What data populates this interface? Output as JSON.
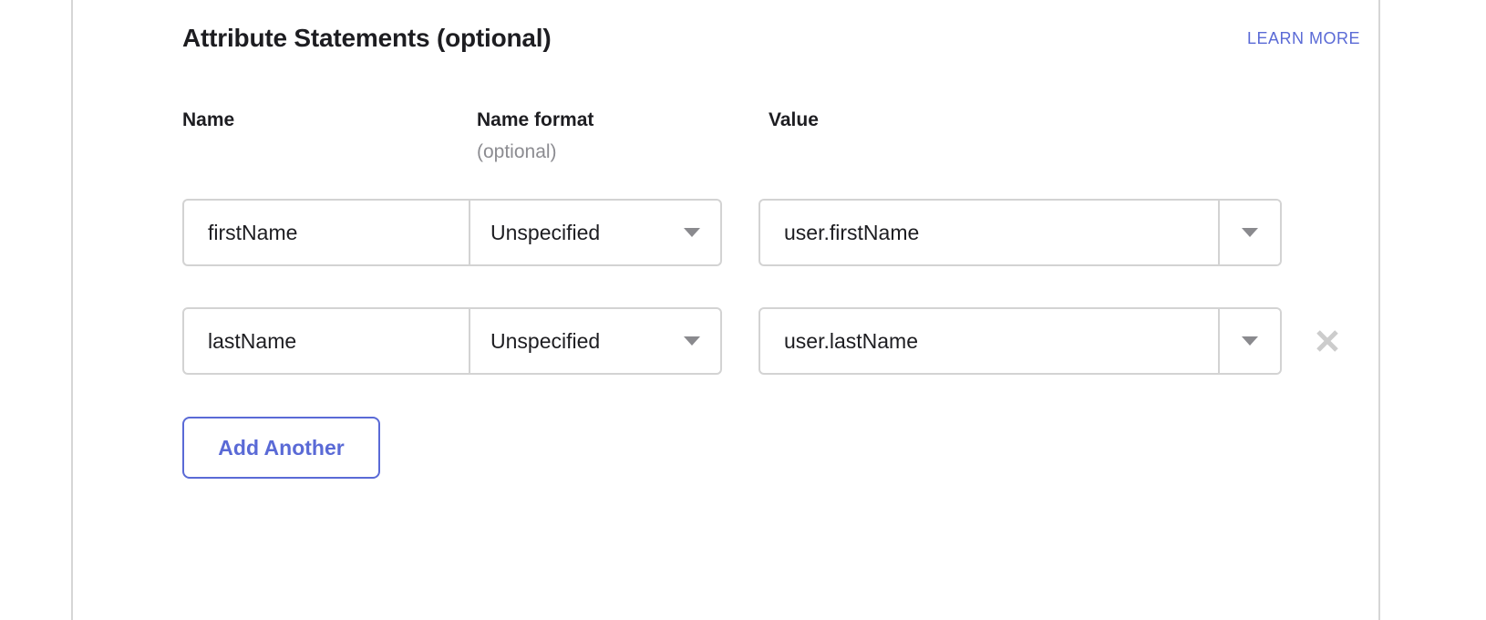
{
  "section": {
    "title": "Attribute Statements (optional)",
    "learn_more_label": "LEARN MORE"
  },
  "colors": {
    "accent": "#5a6ad6",
    "text": "#1d1d21",
    "muted": "#8c8c91",
    "border": "#d3d3d3",
    "divider": "#dcdcdc"
  },
  "columns": {
    "name": "Name",
    "name_format": "Name format",
    "name_format_sub": "(optional)",
    "value": "Value"
  },
  "rows": [
    {
      "name": "firstName",
      "name_format": "Unspecified",
      "value": "user.firstName",
      "has_remove": false
    },
    {
      "name": "lastName",
      "name_format": "Unspecified",
      "value": "user.lastName",
      "has_remove": true
    }
  ],
  "icons": {
    "caret": "chevron-down-icon",
    "remove": "close-icon"
  },
  "actions": {
    "add_another_label": "Add Another"
  }
}
